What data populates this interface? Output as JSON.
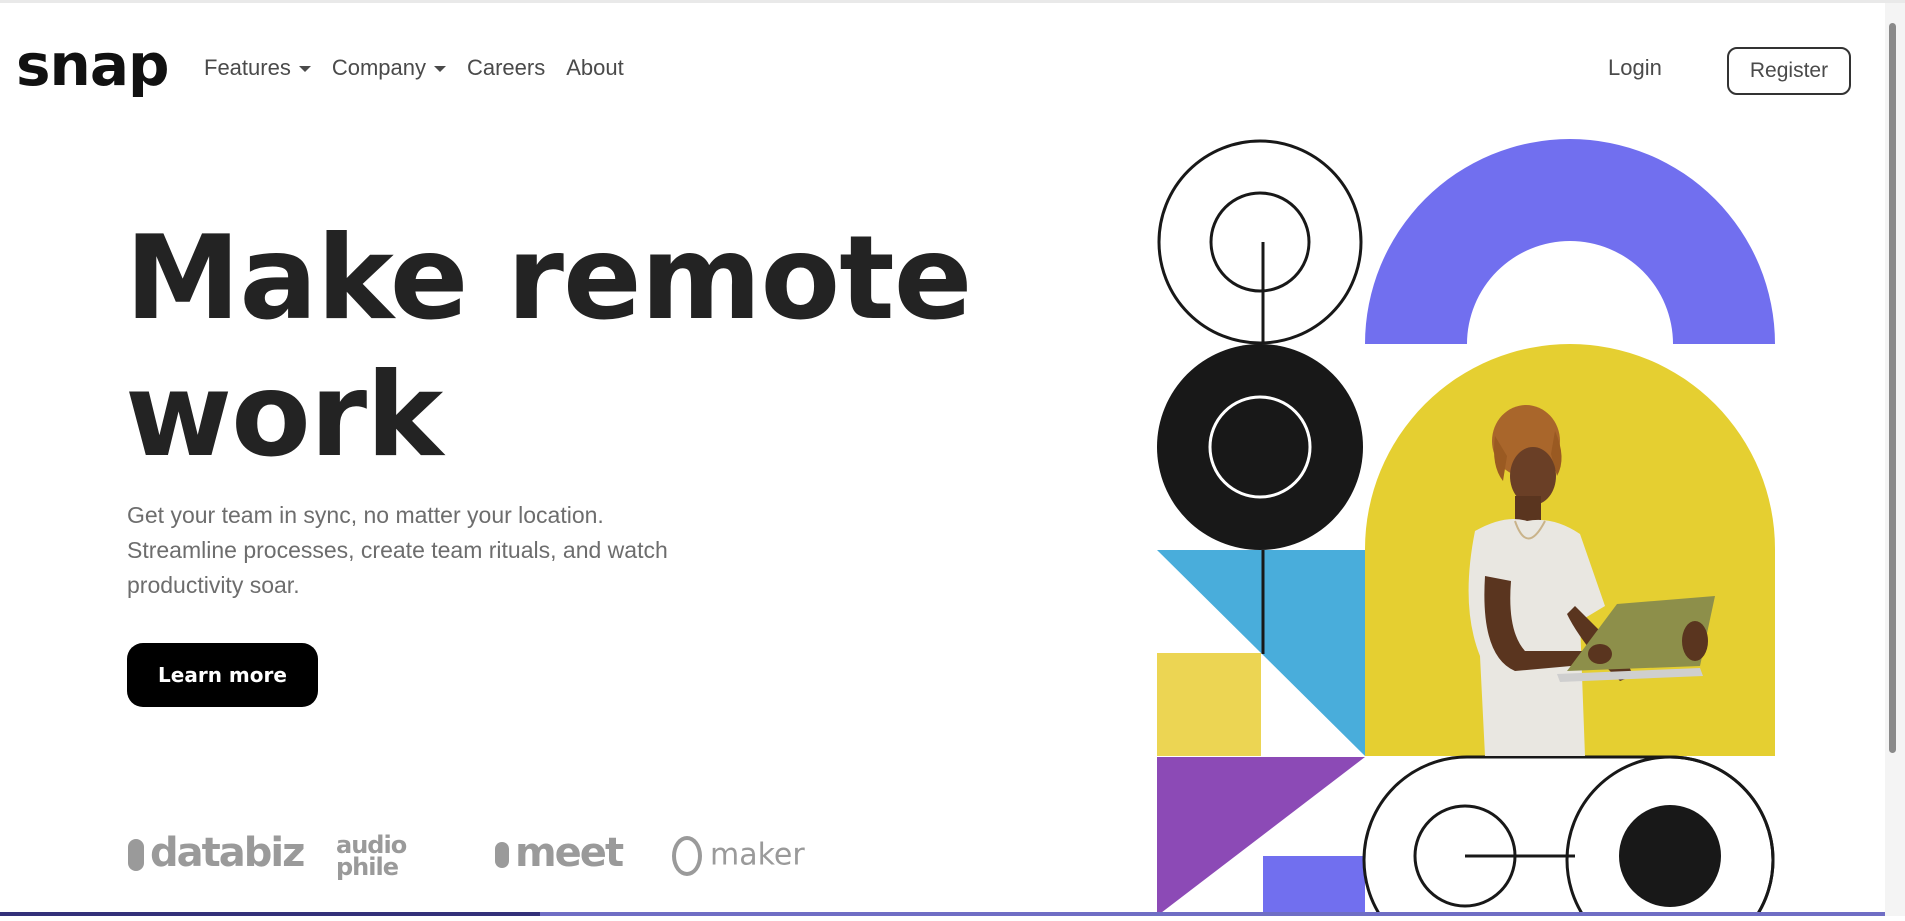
{
  "header": {
    "logo": "snap",
    "nav": [
      {
        "label": "Features",
        "dropdown": true
      },
      {
        "label": "Company",
        "dropdown": true
      },
      {
        "label": "Careers",
        "dropdown": false
      },
      {
        "label": "About",
        "dropdown": false
      }
    ],
    "login_label": "Login",
    "register_label": "Register"
  },
  "hero": {
    "title_line1": "Make remote",
    "title_line2": "work",
    "subtitle_line1": "Get your team in sync, no matter your location.",
    "subtitle_line2": "Streamline processes, create team rituals, and watch",
    "subtitle_line3": "productivity soar.",
    "cta_label": "Learn more"
  },
  "clients": {
    "databiz": "databiz",
    "audiophile_top": "audio",
    "audiophile_bottom": "phile",
    "meet": "meet",
    "maker": "maker"
  },
  "colors": {
    "purple": "#716fef",
    "yellow": "#e5cf31",
    "blue": "#49addb",
    "violet": "#8c4ab6",
    "ink": "#181818",
    "pale_yellow": "#ecd553"
  }
}
